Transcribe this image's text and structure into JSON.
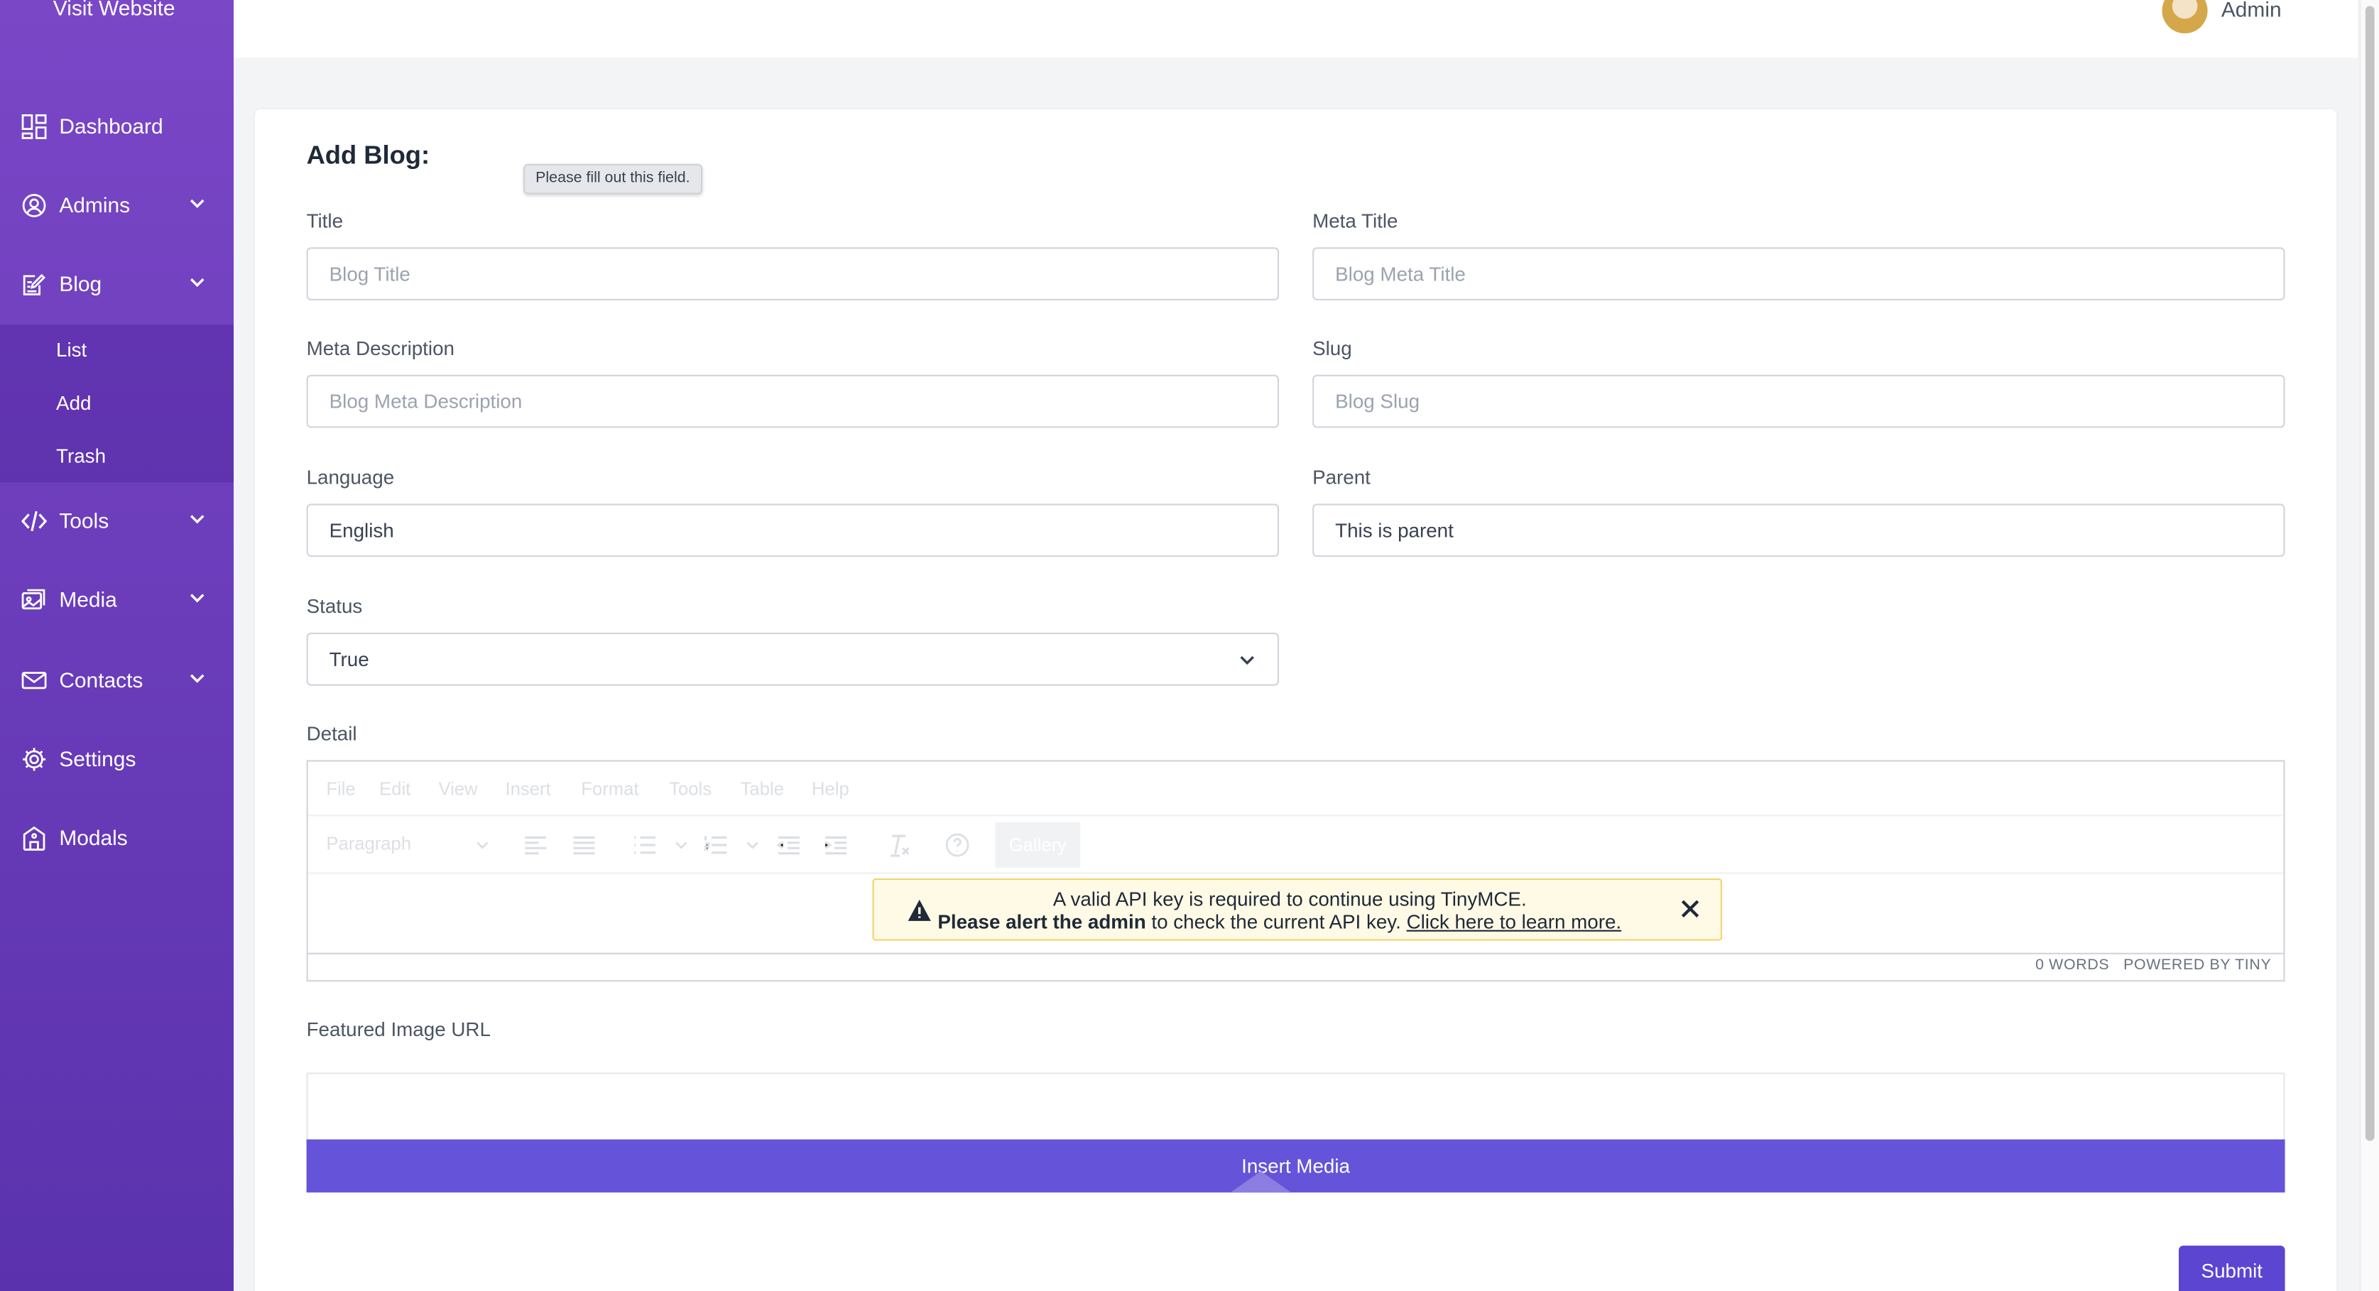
{
  "sidebar": {
    "visit_website": "Visit Website",
    "items": [
      {
        "label": "Dashboard"
      },
      {
        "label": "Admins"
      },
      {
        "label": "Blog"
      },
      {
        "label": "Tools"
      },
      {
        "label": "Media"
      },
      {
        "label": "Contacts"
      },
      {
        "label": "Settings"
      },
      {
        "label": "Modals"
      }
    ],
    "blog_sub": [
      "List",
      "Add",
      "Trash"
    ]
  },
  "header": {
    "user_name": "Admin"
  },
  "form": {
    "heading": "Add Blog:",
    "tooltip": "Please fill out this field.",
    "title": {
      "label": "Title",
      "placeholder": "Blog Title"
    },
    "meta_title": {
      "label": "Meta Title",
      "placeholder": "Blog Meta Title"
    },
    "meta_description": {
      "label": "Meta Description",
      "placeholder": "Blog Meta Description"
    },
    "slug": {
      "label": "Slug",
      "placeholder": "Blog Slug"
    },
    "language": {
      "label": "Language",
      "value": "English"
    },
    "parent": {
      "label": "Parent",
      "value": "This is parent"
    },
    "status": {
      "label": "Status",
      "value": "True"
    },
    "detail": {
      "label": "Detail"
    },
    "featured_image": {
      "label": "Featured Image URL"
    },
    "insert_media": "Insert Media",
    "submit": "Submit"
  },
  "editor": {
    "menu": [
      "File",
      "Edit",
      "View",
      "Insert",
      "Format",
      "Tools",
      "Table",
      "Help"
    ],
    "block_format": "Paragraph",
    "gallery": "Gallery",
    "word_count": "0 WORDS",
    "powered_by": "POWERED BY TINY",
    "notice": {
      "line1": "A valid API key is required to continue using TinyMCE.",
      "bold": "Please alert the admin",
      "middle": " to check the current API key. ",
      "link": "Click here to learn more."
    }
  },
  "colors": {
    "sidebar": "#6a3cba",
    "primary": "#6553d9",
    "submit": "#5c45d1"
  }
}
